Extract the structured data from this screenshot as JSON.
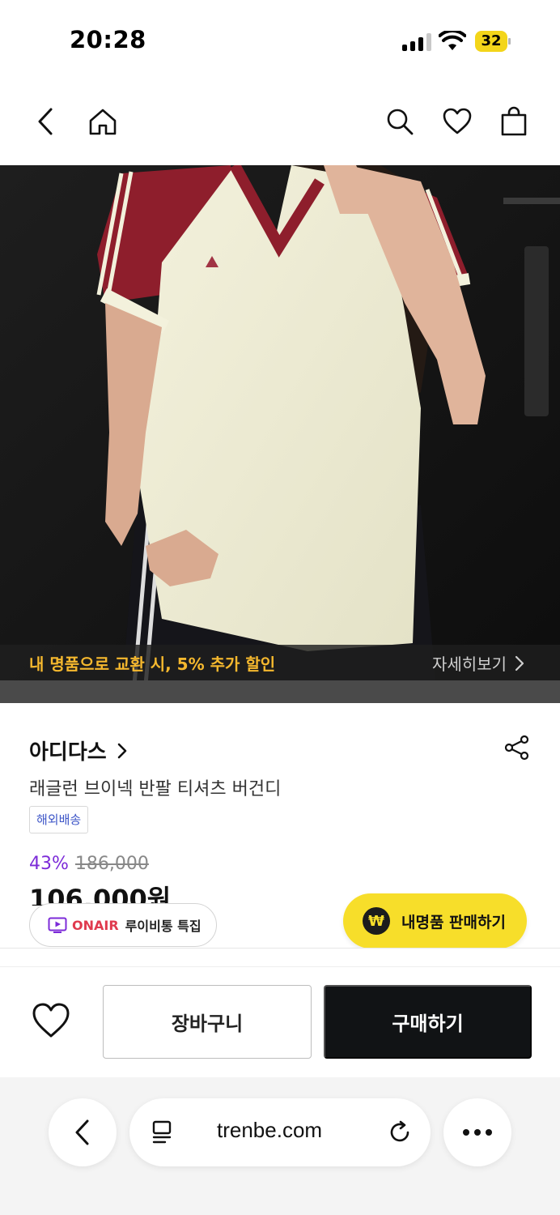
{
  "status_bar": {
    "time": "20:28",
    "battery": "32"
  },
  "nav": {
    "icons": [
      "back-icon",
      "home-icon",
      "search-icon",
      "heart-icon",
      "shopping-bag-icon"
    ]
  },
  "promo": {
    "text": "내 명품으로 교환 시, 5% 추가 할인",
    "link": "자세히보기"
  },
  "product": {
    "brand": "아디다스",
    "name": "래글런 브이넥 반팔 티셔츠 버건디",
    "shipping_badge": "해외배송",
    "discount": "43%",
    "original_price": "186,000",
    "final_price": "106,000원"
  },
  "onair": {
    "label": "ONAIR",
    "title": "루이비통 특집"
  },
  "sell": {
    "label": "내명품 판매하기",
    "icon_text": "₩"
  },
  "purchase": {
    "cart_label": "장바구니",
    "buy_label": "구매하기"
  },
  "browser": {
    "url": "trenbe.com"
  },
  "colors": {
    "accent_yellow": "#f7de2a",
    "discount_purple": "#7c2bd8",
    "promo_orange": "#f5b82e",
    "onair_red": "#e03a4e",
    "buy_black": "#111315"
  }
}
